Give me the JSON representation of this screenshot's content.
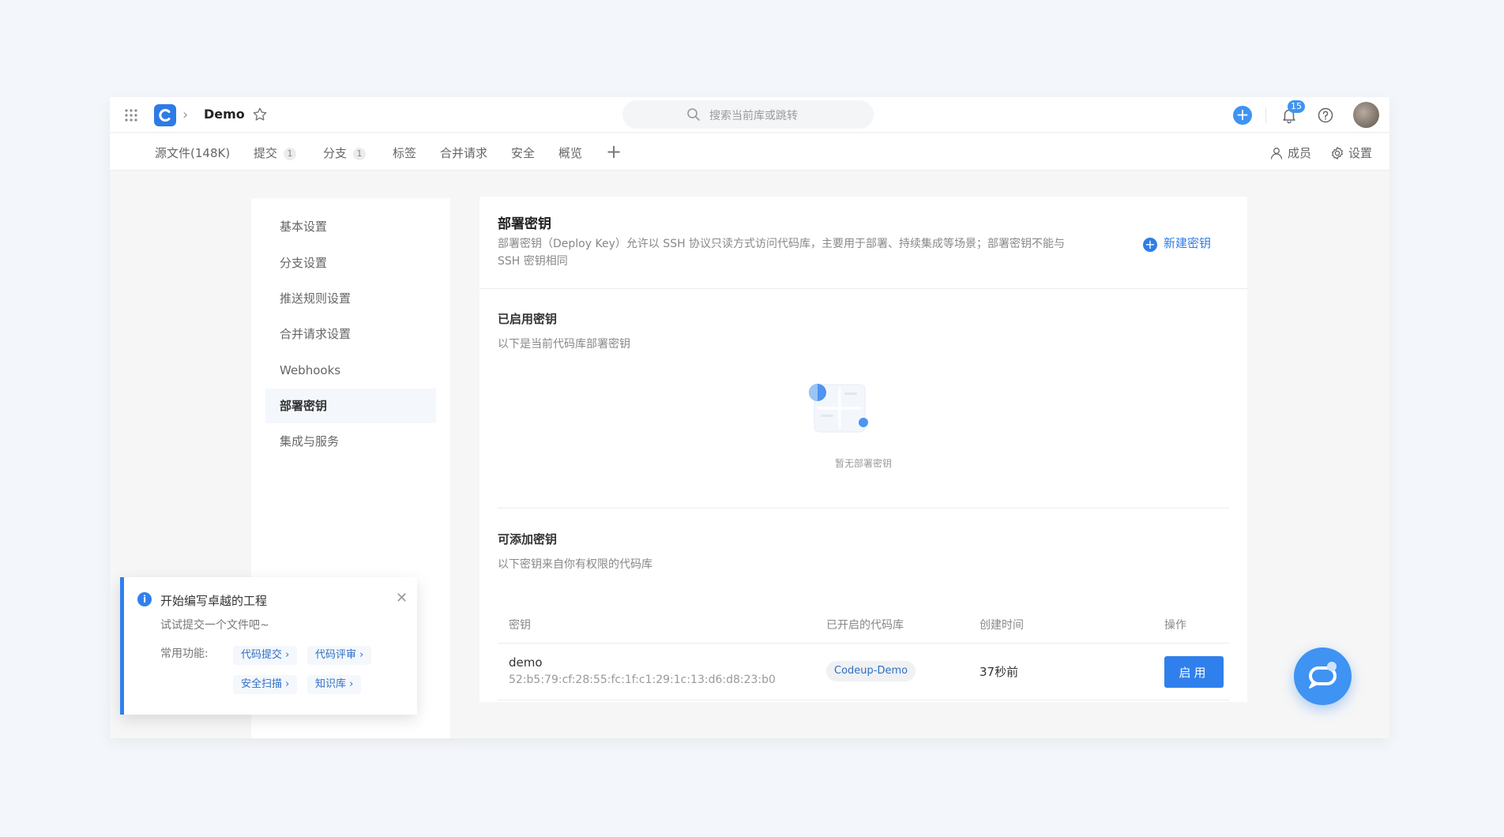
{
  "topbar": {
    "repo_name": "Demo",
    "search_placeholder": "搜索当前库或跳转",
    "notification_count": "15",
    "accent_color": "#3f93f2",
    "icons": [
      "apps-grid-icon",
      "logo-icon",
      "chevron-right-icon",
      "star-icon",
      "search-icon",
      "plus-icon",
      "bell-icon",
      "help-icon"
    ]
  },
  "tabs": [
    {
      "label": "源文件(148K)"
    },
    {
      "label": "提交",
      "count": "1"
    },
    {
      "label": "分支",
      "count": "1"
    },
    {
      "label": "标签"
    },
    {
      "label": "合并请求"
    },
    {
      "label": "安全"
    },
    {
      "label": "概览"
    }
  ],
  "tab_actions": {
    "members": "成员",
    "settings": "设置"
  },
  "sidebar": {
    "items": [
      {
        "label": "基本设置"
      },
      {
        "label": "分支设置"
      },
      {
        "label": "推送规则设置"
      },
      {
        "label": "合并请求设置"
      },
      {
        "label": "Webhooks"
      },
      {
        "label": "部署密钥",
        "active": true
      },
      {
        "label": "集成与服务"
      }
    ]
  },
  "main": {
    "title": "部署密钥",
    "description": "部署密钥（Deploy Key）允许以 SSH 协议只读方式访问代码库，主要用于部署、持续集成等场景；部署密钥不能与 SSH 密钥相同",
    "new_key_label": "新建密钥",
    "enabled": {
      "title": "已启用密钥",
      "subtitle": "以下是当前代码库部署密钥",
      "empty_text": "暂无部署密钥"
    },
    "available": {
      "title": "可添加密钥",
      "subtitle": "以下密钥来自你有权限的代码库",
      "columns": [
        "密钥",
        "已开启的代码库",
        "创建时间",
        "操作"
      ],
      "rows": [
        {
          "name": "demo",
          "fingerprint": "52:b5:79:cf:28:55:fc:1f:c1:29:1c:13:d6:d8:23:b0",
          "repo": "Codeup-Demo",
          "created": "37秒前",
          "action": "启用"
        }
      ]
    }
  },
  "toast": {
    "title": "开始编写卓越的工程",
    "subtitle": "试试提交一个文件吧~",
    "label": "常用功能:",
    "links": [
      "代码提交",
      "代码评审",
      "安全扫描",
      "知识库"
    ]
  }
}
